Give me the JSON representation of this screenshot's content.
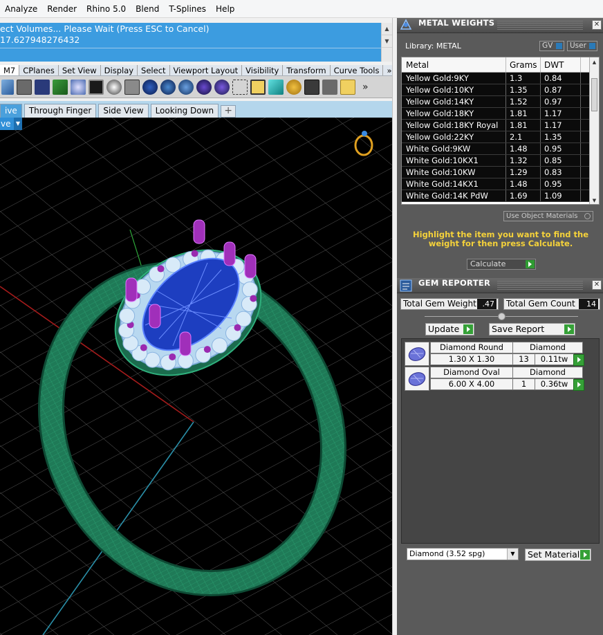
{
  "menu": [
    "Analyze",
    "Render",
    "Rhino 5.0",
    "Blend",
    "T-Splines",
    "Help"
  ],
  "command": {
    "line1": "ect Volumes... Please Wait (Press ESC to Cancel)",
    "line2": "17.627948276432"
  },
  "toolbar_tabs": [
    "M7",
    "CPlanes",
    "Set View",
    "Display",
    "Select",
    "Viewport Layout",
    "Visibility",
    "Transform",
    "Curve Tools",
    "»"
  ],
  "toolbar_overflow": "»",
  "viewport_tabs": [
    "ive",
    "Through Finger",
    "Side View",
    "Looking Down"
  ],
  "viewport_add_tab": "+",
  "viewport_title": "ve",
  "metal_panel": {
    "title": "METAL WEIGHTS",
    "library_label": "Library: METAL",
    "gv_label": "GV",
    "user_label": "User",
    "columns": [
      "Metal",
      "Grams",
      "DWT"
    ],
    "rows": [
      [
        "Yellow Gold:9KY",
        "1.3",
        "0.84"
      ],
      [
        "Yellow Gold:10KY",
        "1.35",
        "0.87"
      ],
      [
        "Yellow Gold:14KY",
        "1.52",
        "0.97"
      ],
      [
        "Yellow Gold:18KY",
        "1.81",
        "1.17"
      ],
      [
        "Yellow Gold:18KY Royal",
        "1.81",
        "1.17"
      ],
      [
        "Yellow Gold:22KY",
        "2.1",
        "1.35"
      ],
      [
        "White Gold:9KW",
        "1.48",
        "0.95"
      ],
      [
        "White Gold:10KX1",
        "1.32",
        "0.85"
      ],
      [
        "White Gold:10KW",
        "1.29",
        "0.83"
      ],
      [
        "White Gold:14KX1",
        "1.48",
        "0.95"
      ],
      [
        "White Gold:14K PdW",
        "1.69",
        "1.09"
      ]
    ],
    "use_object_materials": "Use Object Materials",
    "hint": "Highlight the item you want to find the weight for then press Calculate.",
    "calculate_label": "Calculate"
  },
  "gem_panel": {
    "title": "GEM REPORTER",
    "total_weight_label": "Total Gem Weight",
    "total_weight_value": ".47",
    "total_count_label": "Total Gem Count",
    "total_count_value": "14",
    "update_label": "Update",
    "save_report_label": "Save Report",
    "gems": [
      {
        "shape": "Diamond Round",
        "material": "Diamond",
        "size": "1.30 X 1.30",
        "count": "13",
        "weight": "0.11tw"
      },
      {
        "shape": "Diamond Oval",
        "material": "Diamond",
        "size": "6.00 X 4.00",
        "count": "1",
        "weight": "0.36tw"
      }
    ],
    "material_select": "Diamond     (3.52 spg)",
    "set_material_label": "Set Material"
  },
  "colors": {
    "command_bg": "#3c9ce0",
    "panel_bg": "#5a5a5a",
    "hint_text": "#f5d23a",
    "go_green": "#35a037",
    "ring_green": "#1f8a5e",
    "prong_purple": "#9a2ab0",
    "center_stone_blue": "#1f4fcf"
  }
}
